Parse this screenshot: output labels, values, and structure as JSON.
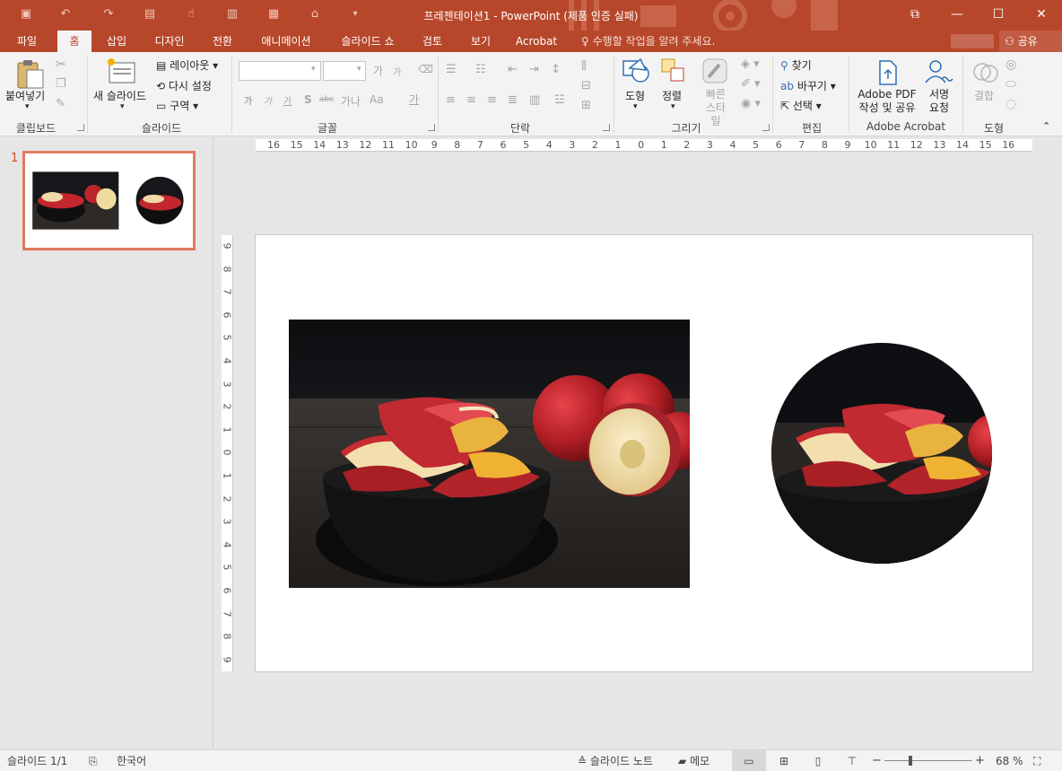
{
  "window": {
    "title": "프레젠테이션1 - PowerPoint (제품 인증 실패)",
    "minimize": "—",
    "restore": "☐",
    "close": "✕",
    "ribbon_display": "⧉"
  },
  "tabs": [
    {
      "label": "파일"
    },
    {
      "label": "홈",
      "active": true
    },
    {
      "label": "삽입"
    },
    {
      "label": "디자인"
    },
    {
      "label": "전환"
    },
    {
      "label": "애니메이션"
    },
    {
      "label": "슬라이드 쇼"
    },
    {
      "label": "검토"
    },
    {
      "label": "보기"
    },
    {
      "label": "Acrobat"
    }
  ],
  "tell_me": "수행할 작업을 알려 주세요.",
  "share": "공유",
  "ribbon": {
    "clipboard": {
      "paste": "붙여넣기",
      "label": "클립보드"
    },
    "slides": {
      "new_slide": "새 슬라이드",
      "layout": "레이아웃",
      "reset": "다시 설정",
      "section": "구역",
      "label": "슬라이드"
    },
    "font": {
      "label": "글꼴",
      "bold": "가",
      "italic": "가",
      "underline": "가",
      "shadow": "S",
      "strike": "abc",
      "spacing": "가나",
      "case": "Aa",
      "clear": "가",
      "grow": "가",
      "shrink": "가"
    },
    "paragraph": {
      "label": "단락"
    },
    "drawing": {
      "shapes": "도형",
      "arrange": "정렬",
      "quick_styles": "빠른 스타일",
      "label": "그리기"
    },
    "editing": {
      "find": "찾기",
      "replace": "바꾸기",
      "select": "선택",
      "label": "편집"
    },
    "acrobat": {
      "create_pdf_line1": "Adobe PDF",
      "create_pdf_line2": "작성 및 공유",
      "sign_line1": "서명",
      "sign_line2": "요청",
      "label": "Adobe Acrobat"
    },
    "shape_group": {
      "merge": "결합",
      "label": "도형"
    }
  },
  "slide_panel": {
    "number": "1"
  },
  "ruler": {
    "h": [
      "16",
      "15",
      "14",
      "13",
      "12",
      "11",
      "10",
      "9",
      "8",
      "7",
      "6",
      "5",
      "4",
      "3",
      "2",
      "1",
      "0",
      "1",
      "2",
      "3",
      "4",
      "5",
      "6",
      "7",
      "8",
      "9",
      "10",
      "11",
      "12",
      "13",
      "14",
      "15",
      "16"
    ],
    "v": [
      "9",
      "8",
      "7",
      "6",
      "5",
      "4",
      "3",
      "2",
      "1",
      "0",
      "1",
      "2",
      "3",
      "4",
      "5",
      "6",
      "7",
      "8",
      "9"
    ]
  },
  "statusbar": {
    "slide_count": "슬라이드 1/1",
    "language": "한국어",
    "notes": "슬라이드 노트",
    "comments": "메모",
    "zoom": "68 %",
    "zoom_level": 68
  },
  "colors": {
    "accent": "#b7472a",
    "thumb_border": "#e07a5f"
  }
}
